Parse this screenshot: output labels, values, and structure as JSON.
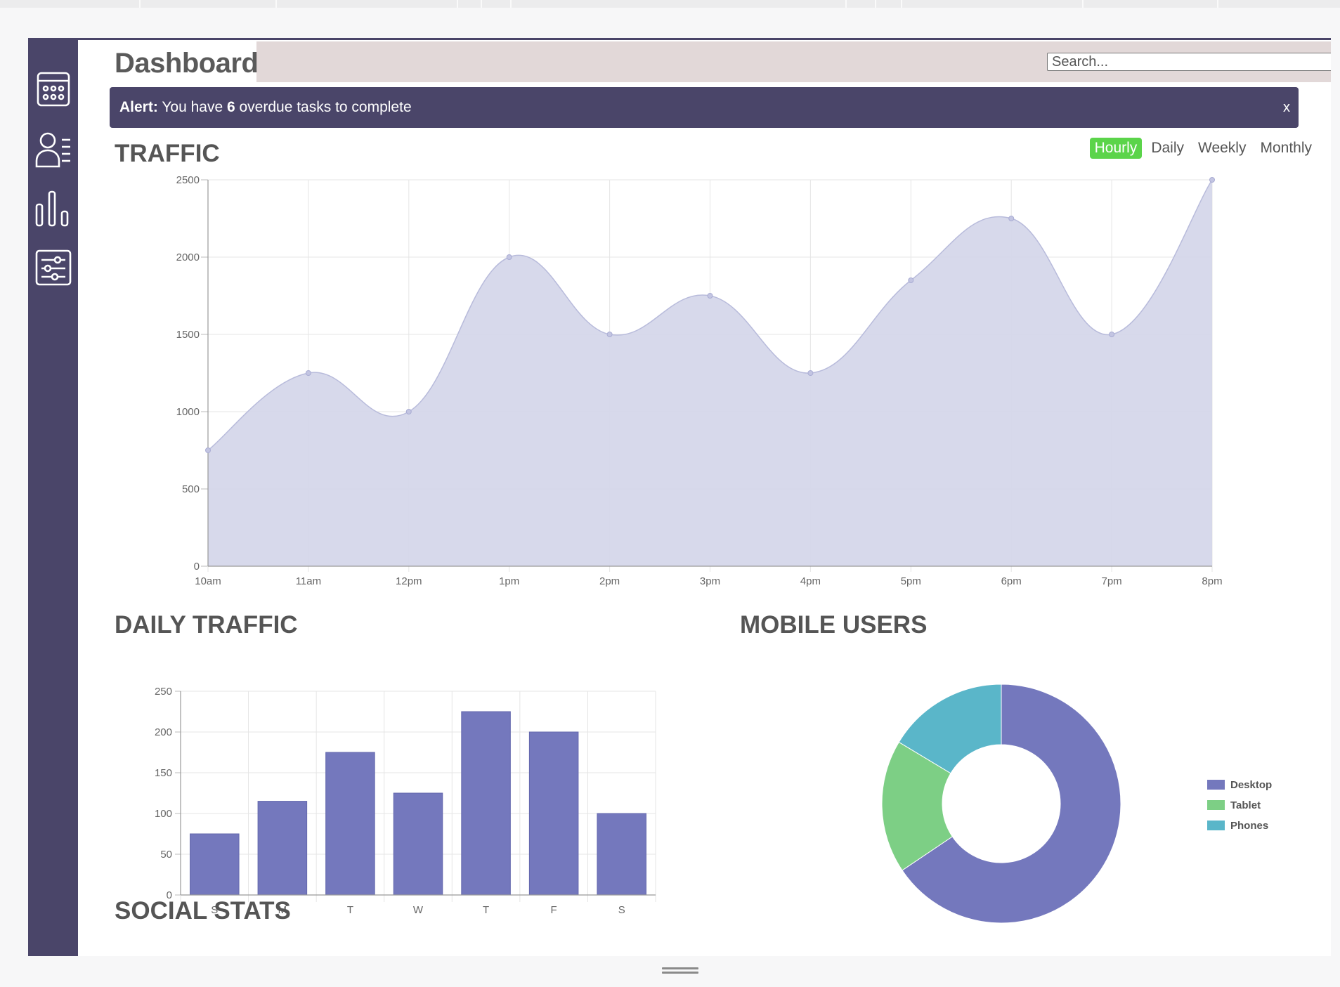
{
  "header": {
    "title": "Dashboard",
    "search_placeholder": "Search..."
  },
  "sidebar": {
    "items": [
      {
        "name": "calendar"
      },
      {
        "name": "members"
      },
      {
        "name": "stats"
      },
      {
        "name": "settings"
      }
    ]
  },
  "alert": {
    "label": "Alert:",
    "text_before": "You have ",
    "count": "6",
    "text_after": " overdue tasks to complete",
    "close": "x"
  },
  "traffic": {
    "title": "TRAFFIC",
    "filters": [
      "Hourly",
      "Daily",
      "Weekly",
      "Monthly"
    ],
    "active_filter": "Hourly"
  },
  "daily_traffic": {
    "title": "DAILY TRAFFIC"
  },
  "mobile_users": {
    "title": "MOBILE USERS"
  },
  "social_stats": {
    "title": "SOCIAL STATS"
  },
  "colors": {
    "sidebar": "#4a4569",
    "active_filter": "#5bd44a",
    "area_fill": "#d5d7ea",
    "bar": "#7478bd",
    "desktop": "#7478bd",
    "tablet": "#7dcf85",
    "phones": "#5ab6c9"
  },
  "chart_data": [
    {
      "type": "area",
      "x": [
        "10am",
        "11am",
        "12pm",
        "1pm",
        "2pm",
        "3pm",
        "4pm",
        "5pm",
        "6pm",
        "7pm",
        "8pm"
      ],
      "values": [
        750,
        1250,
        1000,
        2000,
        1500,
        1750,
        1250,
        1850,
        2250,
        1500,
        2500
      ],
      "yticks": [
        0,
        500,
        1000,
        1500,
        2000,
        2500
      ],
      "ylim": [
        0,
        2500
      ],
      "grid": true
    },
    {
      "type": "bar",
      "categories": [
        "S",
        "M",
        "T",
        "W",
        "T",
        "F",
        "S"
      ],
      "values": [
        75,
        115,
        175,
        125,
        225,
        200,
        100
      ],
      "yticks": [
        0,
        50,
        100,
        150,
        200,
        250
      ],
      "ylim": [
        0,
        250
      ],
      "grid": true
    },
    {
      "type": "pie",
      "labels": [
        "Desktop",
        "Tablet",
        "Phones"
      ],
      "values": [
        2000,
        550,
        500
      ],
      "legend": "right"
    }
  ]
}
